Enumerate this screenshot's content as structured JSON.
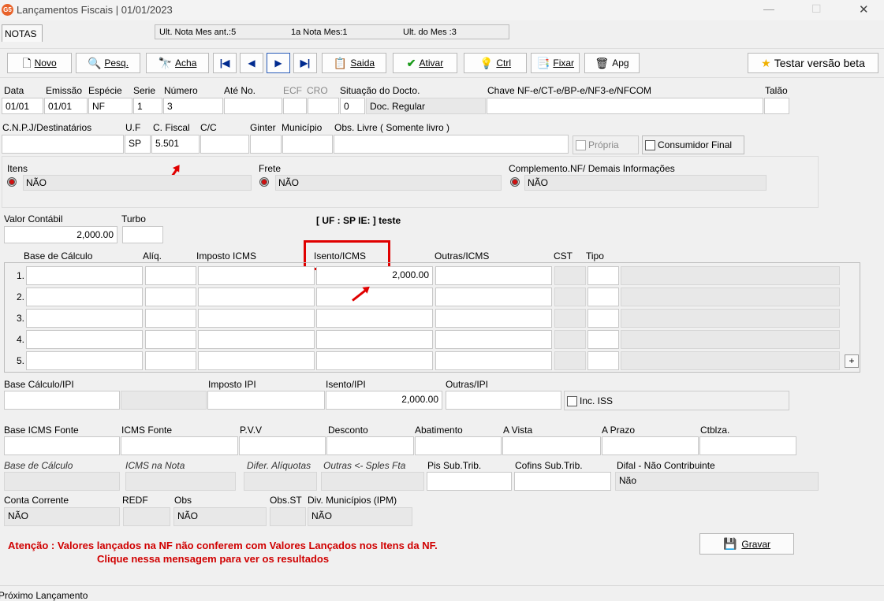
{
  "window": {
    "title": "Lançamentos Fiscais |  01/01/2023",
    "min_glyph": "—",
    "max_glyph": "☐",
    "close_glyph": "✕"
  },
  "notes_tab": "NOTAS",
  "header_info": {
    "ult_nota_ant": "Ult. Nota Mes ant.:5",
    "primeira_nota": "1a Nota Mes:1",
    "ult_mes": "Ult. do Mes :3"
  },
  "toolbar": {
    "novo": "Novo",
    "pesq": "Pesq.",
    "acha": "Acha",
    "first": "|◀",
    "prev": "◀",
    "next": "▶",
    "last": "▶|",
    "saida": "Saida",
    "ativar": "Ativar",
    "ctrl": "Ctrl",
    "fixar": "Fixar",
    "apg": "Apg",
    "testar": "Testar versão beta"
  },
  "labels": {
    "data": "Data",
    "emissao": "Emissão",
    "especie": "Espécie",
    "serie": "Serie",
    "numero": "Número",
    "ate_no": "Até No.",
    "ecf": "ECF",
    "cro": "CRO",
    "situacao": "Situação do Docto.",
    "chave": "Chave NF-e/CT-e/BP-e/NF3-e/NFCOM",
    "talao": "Talão",
    "cnpj": "C.N.P.J/Destinatários",
    "uf": "U.F",
    "cfiscal": "C. Fiscal",
    "cc": "C/C",
    "ginter": "Ginter",
    "municipio": "Município",
    "obs_livre": "Obs. Livre ( Somente livro )",
    "propria": "Própria",
    "consumidor": "Consumidor Final",
    "itens": "Itens",
    "frete": "Frete",
    "complemento": "Complemento.NF/ Demais Informações",
    "valor_contabil": "Valor Contábil",
    "turbo": "Turbo",
    "col_base": "Base de Cálculo",
    "col_aliq": "Alíq.",
    "col_imposto": "Imposto ICMS",
    "col_isento": "Isento/ICMS",
    "col_outras": "Outras/ICMS",
    "col_cst": "CST",
    "col_tipo": "Tipo",
    "base_ipi": "Base Cálculo/IPI",
    "imposto_ipi": "Imposto IPI",
    "isento_ipi": "Isento/IPI",
    "outras_ipi": "Outras/IPI",
    "inc_iss": "Inc. ISS",
    "base_icms_fonte": "Base ICMS Fonte",
    "icms_fonte": "ICMS Fonte",
    "pvv": "P.V.V",
    "desconto": "Desconto",
    "abatimento": "Abatimento",
    "a_vista": "A Vista",
    "a_prazo": "A Prazo",
    "ctblza": "Ctblza.",
    "base_calculo_it": "Base de Cálculo",
    "icms_nota_it": "ICMS na Nota",
    "difer_aliq_it": "Difer. Alíquotas",
    "outras_spl_it": "Outras <- Sples Fta",
    "pis_sub": "Pis Sub.Trib.",
    "cofins_sub": "Cofins Sub.Trib.",
    "difal": "Difal - Não Contribuinte",
    "conta_corrente": "Conta Corrente",
    "redf": "REDF",
    "obs": "Obs",
    "obs_st": "Obs.ST",
    "div_municipios": "Div. Municípios (IPM)"
  },
  "values": {
    "data": "01/01",
    "emissao": "01/01",
    "especie": "NF",
    "serie": "1",
    "numero": "3",
    "situacao_code": "0",
    "situacao_text": "Doc. Regular",
    "uf": "SP",
    "cfiscal": "5.501",
    "itens": "NÃO",
    "frete": "NÃO",
    "complemento": "NÃO",
    "valor_contabil": "2,000.00",
    "uf_ie": "[ UF : SP IE:  ] teste",
    "isento_ipi": "2,000.00",
    "difal": "Não",
    "conta_corrente": "NÃO",
    "obs": "NÃO",
    "div_municipios": "NÃO"
  },
  "rows": [
    {
      "n": "1.",
      "isento": "2,000.00"
    },
    {
      "n": "2.",
      "isento": ""
    },
    {
      "n": "3.",
      "isento": ""
    },
    {
      "n": "4.",
      "isento": ""
    },
    {
      "n": "5.",
      "isento": ""
    }
  ],
  "plus": "+",
  "warning": {
    "line1": "Atenção : Valores lançados na NF não conferem com Valores Lançados nos Itens da NF.",
    "line2": "Clique nessa mensagem para ver os resultados"
  },
  "gravar": "Gravar",
  "status": "Próximo  Lançamento",
  "colors": {
    "accent_red": "#e00000",
    "warning_red": "#d00000"
  }
}
